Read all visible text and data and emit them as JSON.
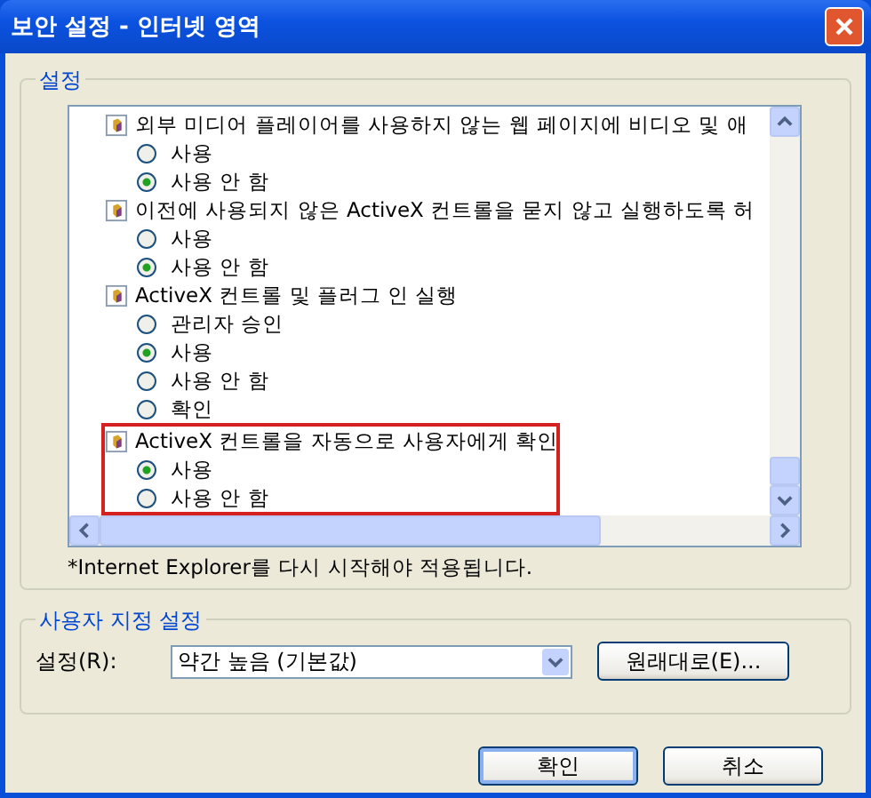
{
  "window": {
    "title": "보안 설정 - 인터넷 영역"
  },
  "settings_group": {
    "label": "설정",
    "items": [
      {
        "label": "외부 미디어 플레이어를 사용하지 않는 웹 페이지에 비디오 및 애",
        "highlighted": false,
        "options": [
          {
            "label": "사용",
            "selected": false
          },
          {
            "label": "사용 안 함",
            "selected": true
          }
        ]
      },
      {
        "label": "이전에 사용되지 않은 ActiveX 컨트롤을 묻지 않고 실행하도록 허",
        "highlighted": false,
        "options": [
          {
            "label": "사용",
            "selected": false
          },
          {
            "label": "사용 안 함",
            "selected": true
          }
        ]
      },
      {
        "label": "ActiveX 컨트롤 및 플러그 인 실행",
        "highlighted": false,
        "options": [
          {
            "label": "관리자 승인",
            "selected": false
          },
          {
            "label": "사용",
            "selected": true
          },
          {
            "label": "사용 안 함",
            "selected": false
          },
          {
            "label": "확인",
            "selected": false
          }
        ]
      },
      {
        "label": "ActiveX 컨트롤을 자동으로 사용자에게 확인",
        "highlighted": true,
        "options": [
          {
            "label": "사용",
            "selected": true
          },
          {
            "label": "사용 안 함",
            "selected": false
          }
        ]
      }
    ],
    "note": "*Internet Explorer를 다시 시작해야 적용됩니다."
  },
  "custom_group": {
    "label": "사용자 지정 설정",
    "field_label": "설정(R):",
    "dropdown": {
      "value": "약간 높음 (기본값)"
    },
    "reset_button": "원래대로(E)..."
  },
  "buttons": [
    {
      "label": "확인",
      "default": true
    },
    {
      "label": "취소",
      "default": false
    }
  ]
}
